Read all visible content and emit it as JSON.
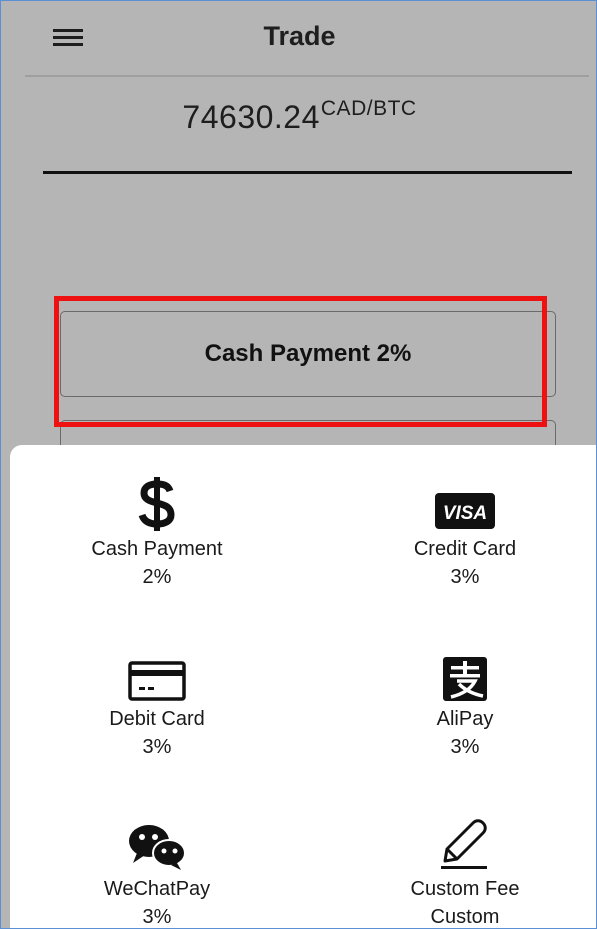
{
  "app_bar": {
    "title": "Trade",
    "menu_icon": "hamburger-menu-icon"
  },
  "rate": {
    "value": "74630.24",
    "unit": "CAD/BTC"
  },
  "payment_select": {
    "label": "Cash Payment 2%"
  },
  "highlight": {
    "color": "#ee1111"
  },
  "sheet": {
    "options": [
      {
        "label": "Cash Payment",
        "fee": "2%",
        "icon": "dollar-sign-icon"
      },
      {
        "label": "Credit Card",
        "fee": "3%",
        "icon": "visa-icon",
        "icon_text": "VISA"
      },
      {
        "label": "Debit Card",
        "fee": "3%",
        "icon": "card-icon"
      },
      {
        "label": "AliPay",
        "fee": "3%",
        "icon": "alipay-icon"
      },
      {
        "label": "WeChatPay",
        "fee": "3%",
        "icon": "wechat-icon"
      },
      {
        "label": "Custom Fee",
        "fee": "Custom",
        "icon": "pencil-icon"
      }
    ]
  },
  "colors": {
    "scrim": "#b5b5b5",
    "sheet_bg": "#ffffff",
    "text": "#1a1a1a"
  }
}
